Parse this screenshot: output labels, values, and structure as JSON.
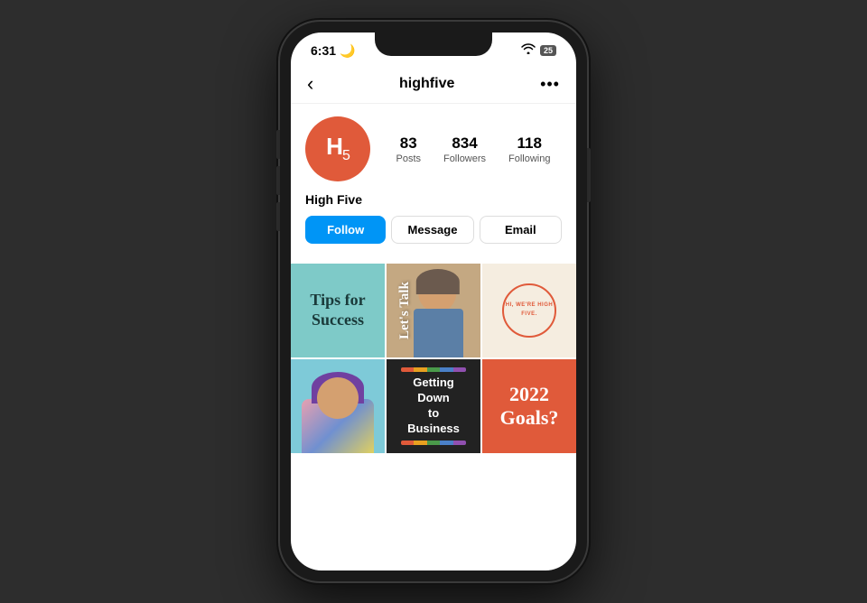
{
  "phone": {
    "status": {
      "time": "6:31",
      "moon": "🌙",
      "wifi": "wifi",
      "battery": "25"
    },
    "nav": {
      "back": "‹",
      "title": "highfive",
      "more": "•••"
    },
    "profile": {
      "avatar_initials": "H₅",
      "name": "High Five",
      "stats": {
        "posts_count": "83",
        "posts_label": "Posts",
        "followers_count": "834",
        "followers_label": "Followers",
        "following_count": "118",
        "following_label": "Following"
      },
      "buttons": {
        "follow": "Follow",
        "message": "Message",
        "email": "Email"
      }
    },
    "posts": [
      {
        "type": "tips",
        "text": "Tips for Success"
      },
      {
        "type": "lets_talk",
        "text": "Let's Talk"
      },
      {
        "type": "hi",
        "text": "HI, WE'RE HIGH FIVE."
      },
      {
        "type": "person",
        "text": ""
      },
      {
        "type": "business",
        "text": "Getting Down to Business"
      },
      {
        "type": "goals",
        "text": "2022 Goals?"
      }
    ],
    "colors": {
      "follow_bg": "#0095f6",
      "avatar_bg": "#e05a3a",
      "teal": "#7ecac8",
      "amber": "#e8a020",
      "cream": "#f5ede0",
      "sky": "#7ecad8",
      "dark": "#222222",
      "coral": "#e05a3a"
    }
  }
}
